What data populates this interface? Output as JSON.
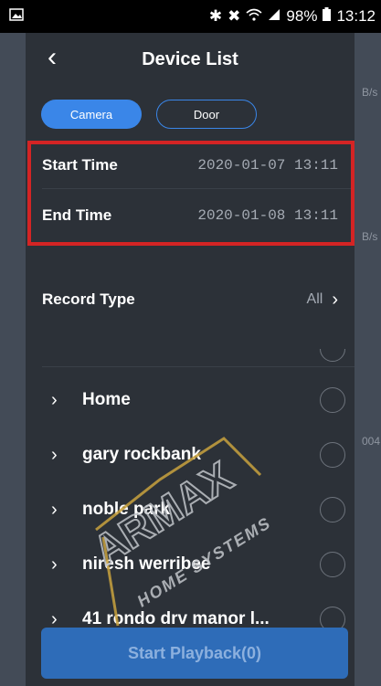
{
  "statusbar": {
    "battery": "98%",
    "time": "13:12"
  },
  "background_right_labels": [
    "B/s",
    "B/s",
    "004"
  ],
  "nav": {
    "title": "Device List"
  },
  "tabs": [
    {
      "label": "Camera",
      "active": true
    },
    {
      "label": "Door",
      "active": false
    }
  ],
  "time_range": {
    "start_label": "Start Time",
    "start_value": "2020-01-07 13:11",
    "end_label": "End Time",
    "end_value": "2020-01-08 13:11"
  },
  "record_type": {
    "label": "Record Type",
    "value": "All"
  },
  "devices": [
    {
      "name": "Home"
    },
    {
      "name": "gary rockbank"
    },
    {
      "name": "noble park"
    },
    {
      "name": "niresh werribee"
    },
    {
      "name": "41 rondo drv manor l..."
    }
  ],
  "playback_button": "Start Playback(0)",
  "watermark": {
    "brand": "ARMAX",
    "tagline": "HOME SYSTEMS"
  },
  "colors": {
    "accent": "#3a86e8",
    "highlight_box": "#d42424",
    "panel_bg": "#2c3138"
  }
}
